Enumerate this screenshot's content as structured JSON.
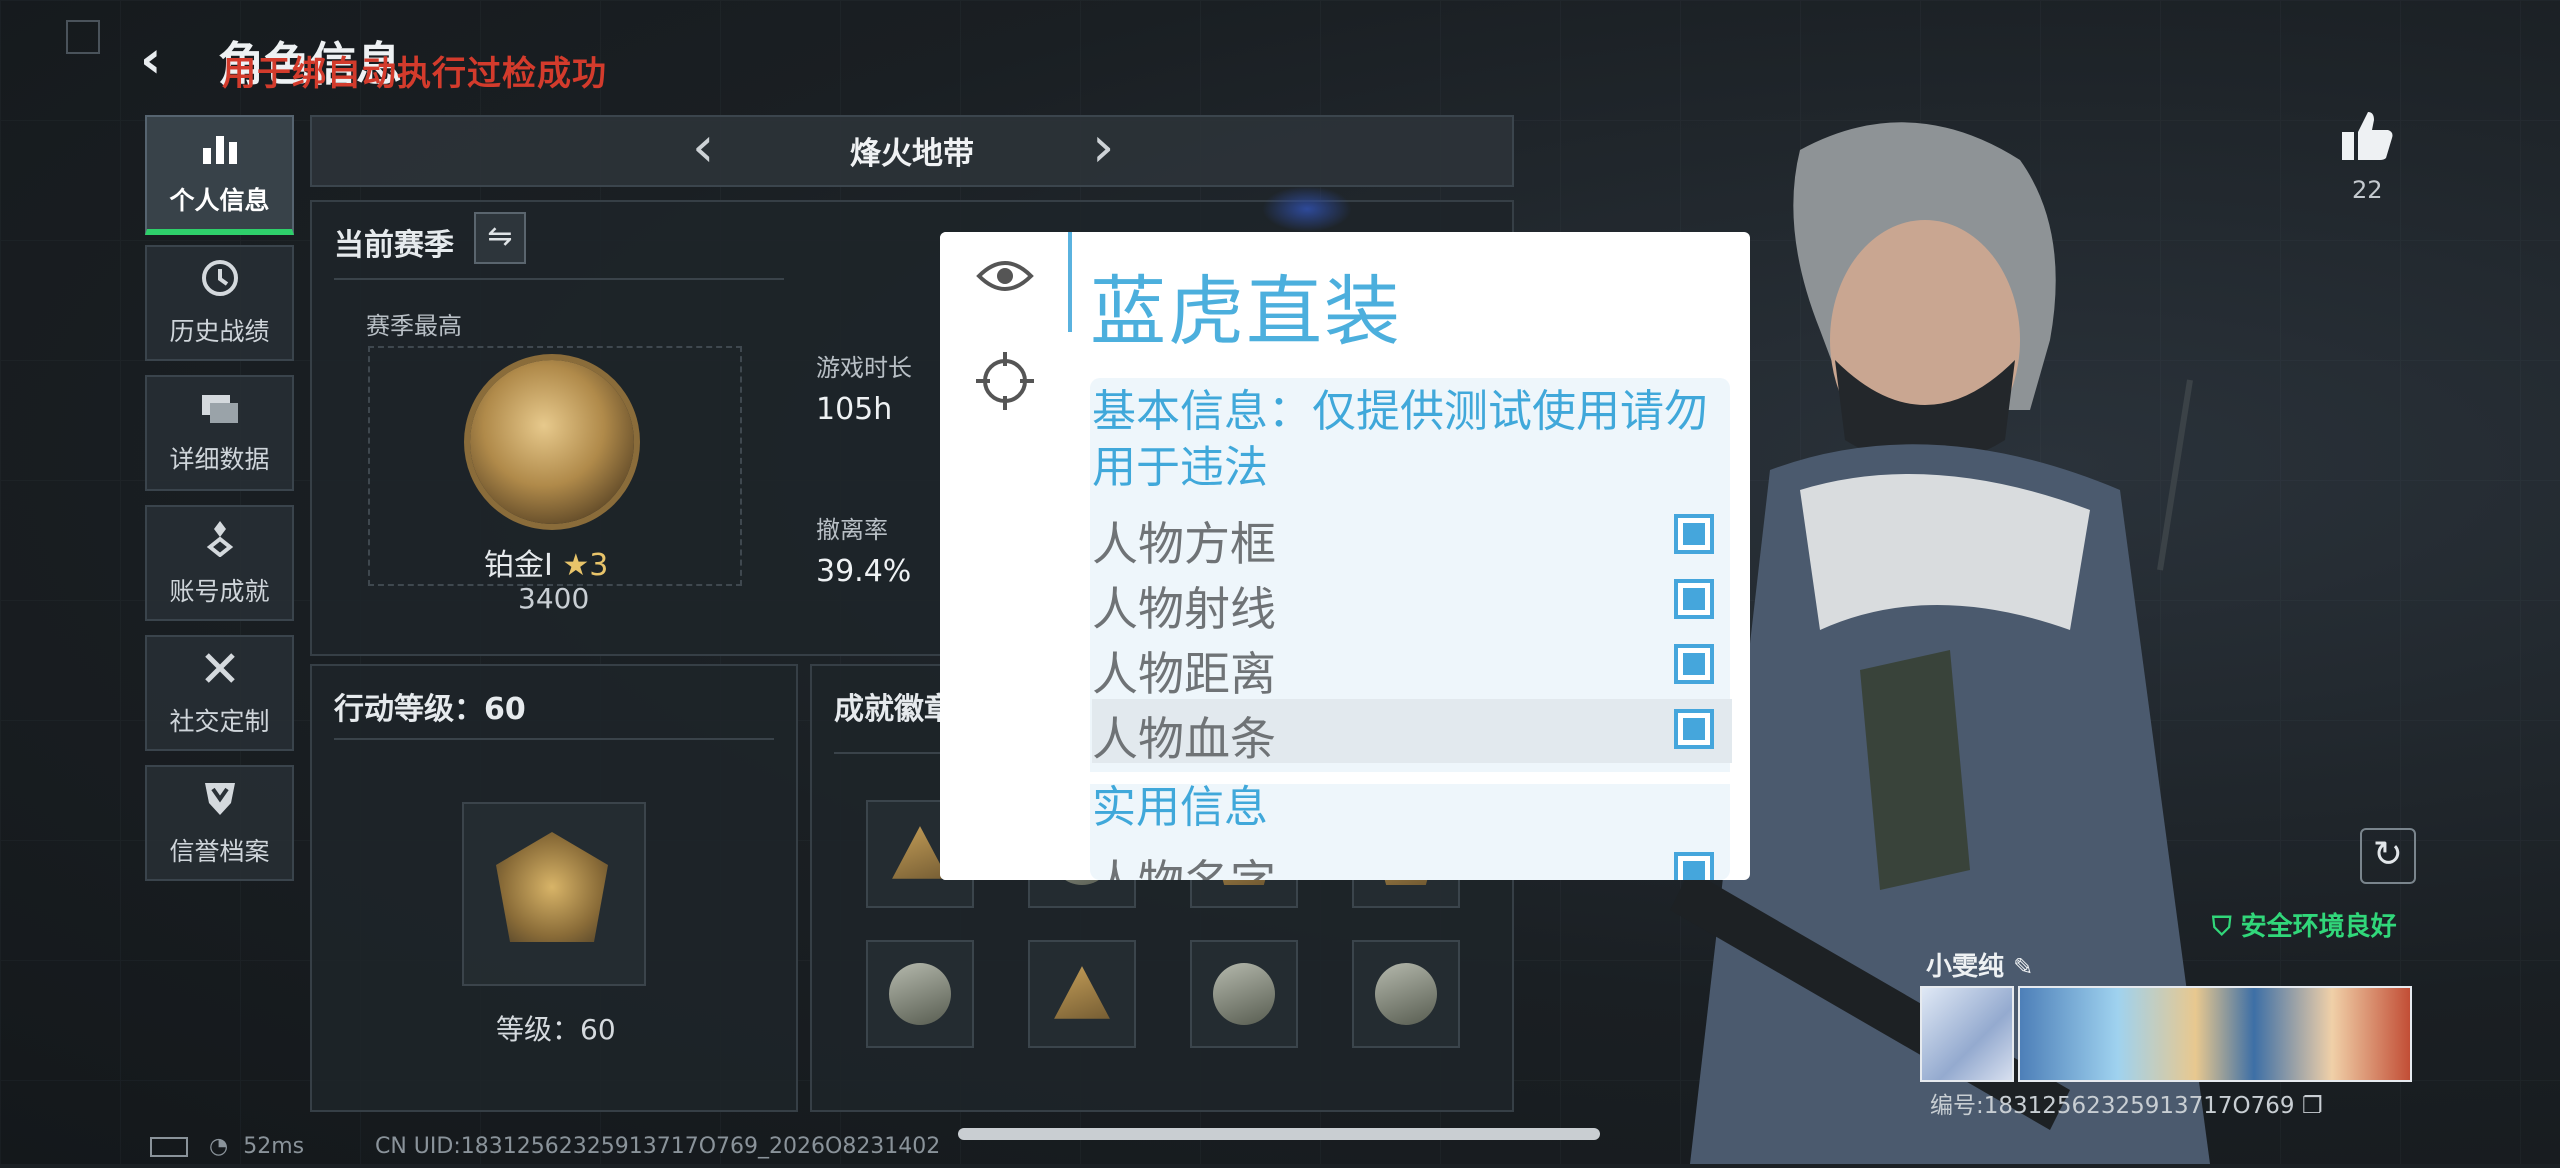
{
  "header": {
    "title": "角色信息",
    "overlay_message": "用于绑自动执行过检成功"
  },
  "sidebar": {
    "items": [
      {
        "label": "个人信息",
        "icon": "bar-chart-icon",
        "active": true
      },
      {
        "label": "历史战绩",
        "icon": "clock-icon",
        "active": false
      },
      {
        "label": "详细数据",
        "icon": "folders-icon",
        "active": false
      },
      {
        "label": "账号成就",
        "icon": "trophy-icon",
        "active": false
      },
      {
        "label": "社交定制",
        "icon": "tools-icon",
        "active": false
      },
      {
        "label": "信誉档案",
        "icon": "shield-icon",
        "active": false
      }
    ]
  },
  "mode": {
    "name": "烽火地带",
    "prev": "‹",
    "next": "›"
  },
  "season": {
    "title": "当前赛季",
    "swap_icon": "⇋",
    "highest_label": "赛季最高",
    "rank_name": "铂金Ⅰ",
    "rank_stars": "★3",
    "rank_score": "3400",
    "playtime_label": "游戏时长",
    "playtime_value": "105h",
    "extract_label": "撤离率",
    "extract_value": "39.4%"
  },
  "action_level": {
    "title": "行动等级：60",
    "level_text": "等级：60"
  },
  "achievements": {
    "title": "成就徽章"
  },
  "menu": {
    "title": "蓝虎直装",
    "section_basic": "基本信息：仅提供测试使用请勿用于违法",
    "options": [
      {
        "label": "人物方框",
        "checked": true
      },
      {
        "label": "人物射线",
        "checked": true
      },
      {
        "label": "人物距离",
        "checked": true
      },
      {
        "label": "人物血条",
        "checked": true
      }
    ],
    "section_util": "实用信息",
    "util_options": [
      {
        "label": "人物名字",
        "checked": true
      }
    ]
  },
  "right": {
    "like_count": "22",
    "safe_text": "安全环境良好",
    "player_name": "小雯纯",
    "player_id": "编号:18312562325913717O769"
  },
  "status_bar": {
    "ping": "52ms",
    "uid": "CN UID:18312562325913717O769_2026O8231402"
  }
}
